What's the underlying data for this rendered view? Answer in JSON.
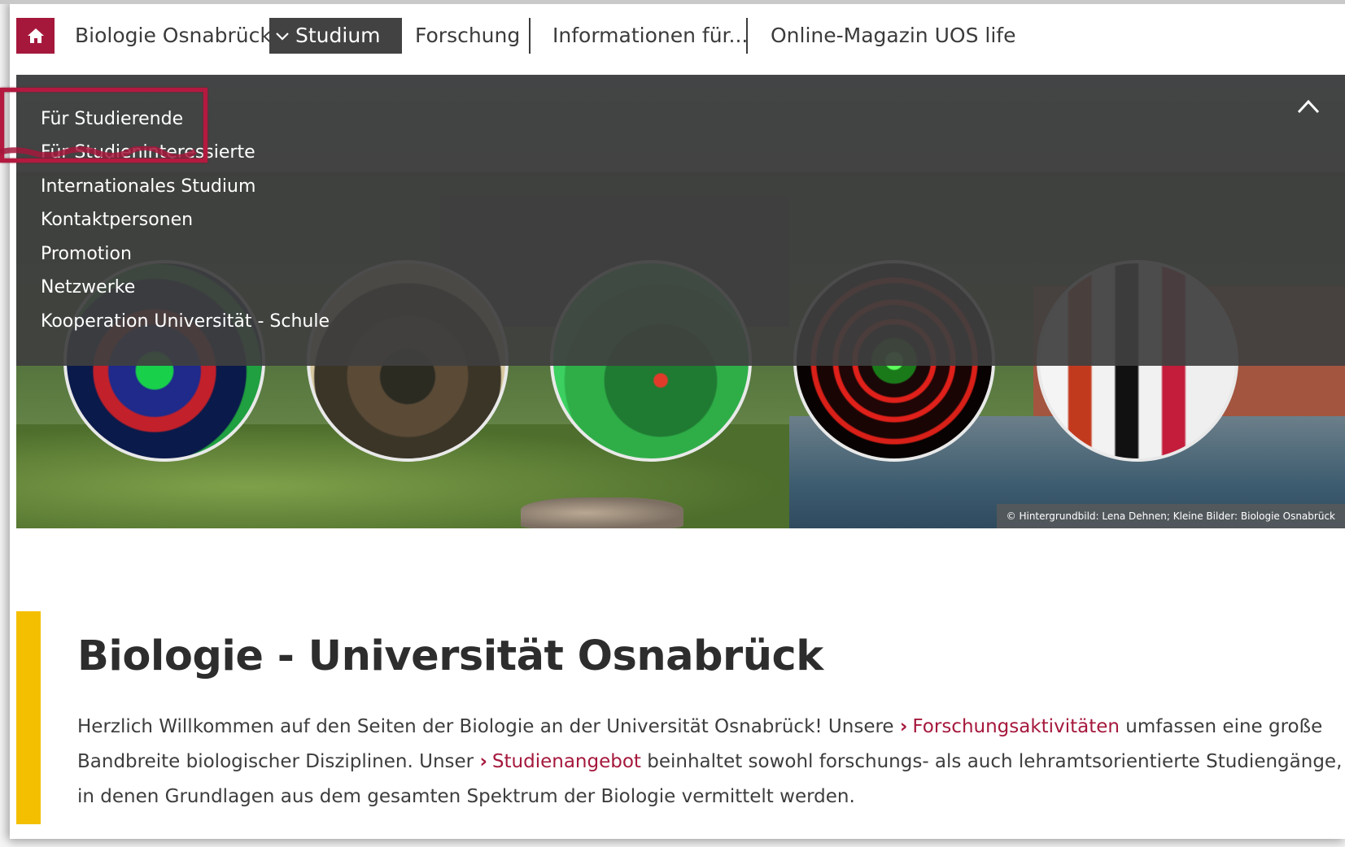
{
  "nav": {
    "home_icon": "home-icon",
    "site": "Biologie Osnabrück",
    "studium": "Studium",
    "forschung": "Forschung",
    "info": "Informationen für...",
    "magazin": "Online-Magazin UOS life"
  },
  "dropdown": {
    "items": [
      "Für Studierende",
      "Für Studieninteressierte",
      "Internationales Studium",
      "Kontaktpersonen",
      "Promotion",
      "Netzwerke",
      "Kooperation Universität - Schule"
    ],
    "close_icon": "chevron-up-icon"
  },
  "hero": {
    "credit": "© Hintergrundbild: Lena Dehnen; Kleine Bilder: Biologie Osnabrück"
  },
  "content": {
    "title": "Biologie - Universität Osnabrück",
    "p1": "Herzlich Willkommen auf den Seiten der Biologie an der Universität Osnabrück! Unsere",
    "link1": "Forschungsaktivitäten",
    "p2": "umfassen eine große Bandbreite biologischer Disziplinen. Unser",
    "link2": "Studienangebot",
    "p3": "beinhaltet sowohl forschungs- als auch lehramtsorientierte Studiengänge, in denen Grundlagen aus dem gesamten Spektrum der Biologie vermittelt werden.",
    "link_arrow": "›"
  },
  "colors": {
    "brand": "#a5183c",
    "accent_bar": "#f4bf00",
    "dropdown_bg": "#404040"
  }
}
